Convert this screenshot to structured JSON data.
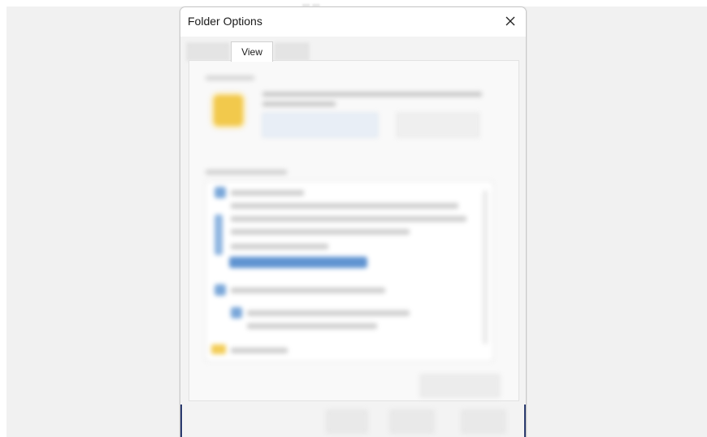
{
  "background_window": {
    "partial_title": "... ..."
  },
  "dialog": {
    "title": "Folder Options",
    "close_icon": "close-icon"
  },
  "tabs": [
    {
      "label": "",
      "state": "obscured"
    },
    {
      "label": "View",
      "state": "active"
    },
    {
      "label": "",
      "state": "obscured"
    }
  ],
  "panel": {
    "content_state": "blurred"
  },
  "colors": {
    "backdrop": "#f1f1f1",
    "dialog_bg": "#f3f3f3",
    "titlebar_bg": "#ffffff",
    "folder_icon": "#f2c94c",
    "selection_blue": "#5f93d1",
    "window_edge": "#2a3a6e"
  }
}
